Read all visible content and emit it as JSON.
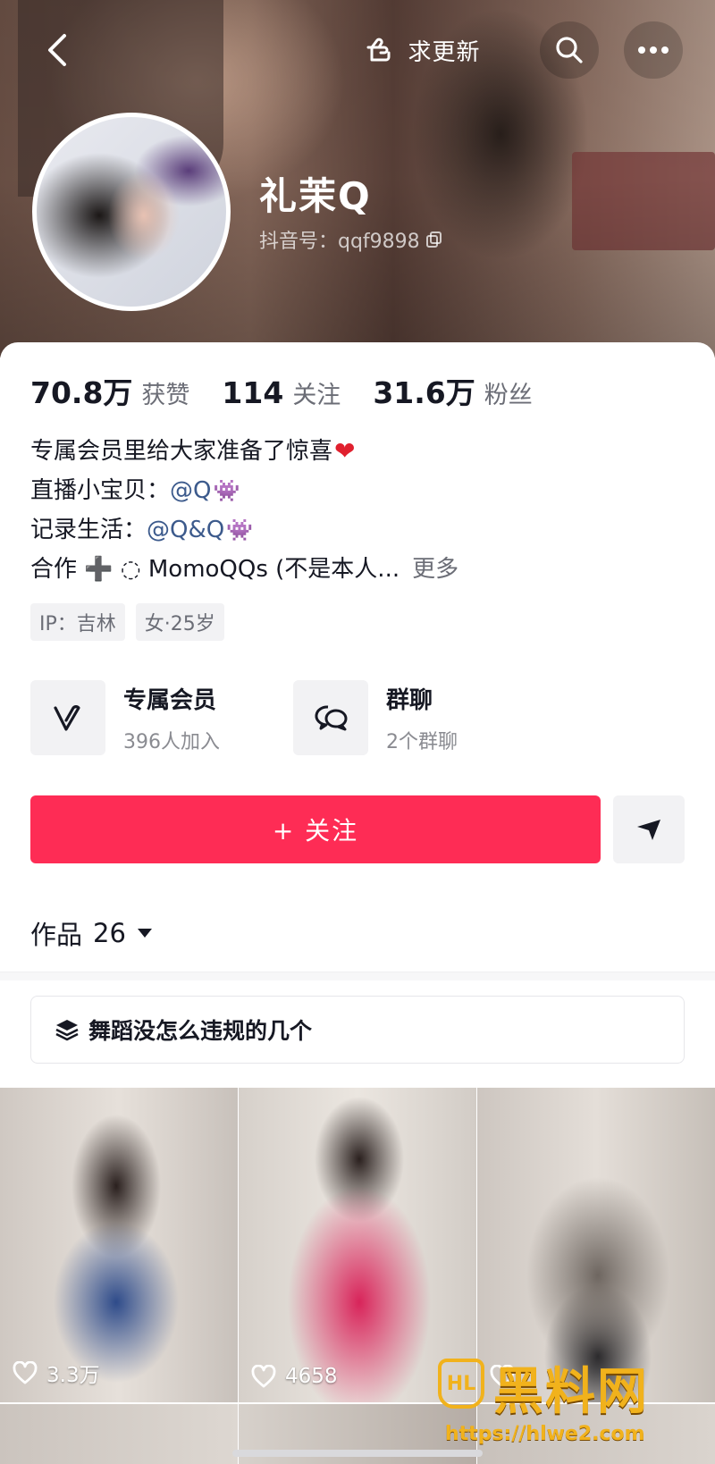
{
  "header": {
    "request_update_label": "求更新",
    "nickname": "礼茉Q",
    "douyin_id": "抖音号：qqf9898"
  },
  "stats": [
    {
      "value": "70.8万",
      "label": "获赞"
    },
    {
      "value": "114",
      "label": "关注"
    },
    {
      "value": "31.6万",
      "label": "粉丝"
    }
  ],
  "bio": {
    "line1": "专属会员里给大家准备了惊喜",
    "line2_prefix": "直播小宝贝：",
    "line2_mention": "@Q",
    "line3_prefix": "记录生活：",
    "line3_mention": "@Q&Q",
    "line4_text": "合作 ➕ ◌ MomoQQs (不是本人...",
    "more_label": "更多"
  },
  "tags": [
    "IP：吉林",
    "女·25岁"
  ],
  "entries": {
    "membership": {
      "title": "专属会员",
      "subtitle": "396人加入"
    },
    "group_chat": {
      "title": "群聊",
      "subtitle": "2个群聊"
    }
  },
  "actions": {
    "follow_label": "+ 关注"
  },
  "works": {
    "tab_label": "作品",
    "count": "26"
  },
  "collection": {
    "title": "舞蹈没怎么违规的几个"
  },
  "videos": [
    {
      "likes": "3.3万"
    },
    {
      "likes": "4658"
    },
    {
      "likes": ""
    }
  ],
  "watermark": {
    "logo_text": "HL",
    "name": "黑料网",
    "url": "https://hlwe2.com"
  },
  "colors": {
    "accent": "#fe2c55",
    "mention": "#3c5a8c",
    "watermark": "#f1b21c"
  }
}
